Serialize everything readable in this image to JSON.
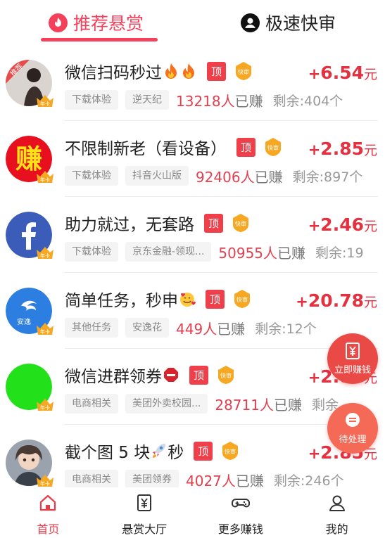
{
  "tabs": [
    {
      "label": "推荐悬赏",
      "icon": "flame-icon",
      "active": true
    },
    {
      "label": "极速快审",
      "icon": "user-circle-icon",
      "active": false
    }
  ],
  "tasks": [
    {
      "title": "微信扫码秒过",
      "title_emojis": [
        "fire-icon",
        "fire-icon"
      ],
      "avatar": "recommend-girl-avatar",
      "top_badge": "顶",
      "fast_badge": "快审",
      "tags": [
        "下载体验",
        "逆天纪"
      ],
      "earned": "13218人",
      "earned_suffix": "已赚",
      "remain": "剩余:404个",
      "price_plus": "+",
      "price": "6.54",
      "price_unit": "元"
    },
    {
      "title": "不限制新老（看设备）",
      "title_emojis": [],
      "avatar": "zhuan-char-avatar",
      "top_badge": "顶",
      "fast_badge": "快审",
      "tags": [
        "下载体验",
        "抖音火山版"
      ],
      "earned": "92406人",
      "earned_suffix": "已赚",
      "remain": "剩余:897个",
      "price_plus": "+",
      "price": "2.85",
      "price_unit": "元"
    },
    {
      "title": "助力就过，无套路",
      "title_emojis": [],
      "avatar": "facebook-avatar",
      "top_badge": "顶",
      "fast_badge": "快审",
      "tags": [
        "下载体验",
        "京东金融-领现..."
      ],
      "earned": "50955人",
      "earned_suffix": "已赚",
      "remain": "剩余:19",
      "price_plus": "+",
      "price": "2.46",
      "price_unit": "元"
    },
    {
      "title": "简单任务，秒申",
      "title_emojis": [
        "smiling-hearts-icon"
      ],
      "avatar": "anyihua-logo-avatar",
      "top_badge": "顶",
      "fast_badge": "快审",
      "tags": [
        "其他任务",
        "安逸花"
      ],
      "earned": "449人",
      "earned_suffix": "已赚",
      "remain": "剩余:12个",
      "price_plus": "+",
      "price": "20.78",
      "price_unit": "元"
    },
    {
      "title": "微信进群领券",
      "title_emojis": [
        "stop-sign-icon"
      ],
      "avatar": "green-circle-avatar",
      "top_badge": "顶",
      "fast_badge": "快审",
      "tags": [
        "电商相关",
        "美团外卖校园..."
      ],
      "earned": "28711人",
      "earned_suffix": "已赚",
      "remain": "剩余",
      "price_plus": "+",
      "price": "2.85",
      "price_unit": "元"
    },
    {
      "title": "截个图 5 块",
      "title_suffix": "秒",
      "title_emojis": [
        "rocket-icon"
      ],
      "avatar": "anime-girl-avatar",
      "top_badge": "顶",
      "fast_badge": "快审",
      "tags": [
        "电商相关",
        "美团领券"
      ],
      "earned": "4027人",
      "earned_suffix": "已赚",
      "remain": "剩余:246个",
      "price_plus": "+",
      "price": "2.85",
      "price_unit": "元"
    }
  ],
  "year_badge_text": "年卡",
  "float_buttons": {
    "earn": "立即赚钱",
    "pending": "待处理"
  },
  "nav": [
    {
      "label": "首页",
      "icon": "home-icon",
      "active": true
    },
    {
      "label": "悬赏大厅",
      "icon": "yuan-doc-icon",
      "active": false
    },
    {
      "label": "更多赚钱",
      "icon": "gamepad-icon",
      "active": false
    },
    {
      "label": "我的",
      "icon": "person-icon",
      "active": false
    }
  ],
  "colors": {
    "accent": "#f4405a",
    "price": "#e4303f",
    "top_badge": "#ef3f4a",
    "fast_badge": "#f7a823"
  }
}
